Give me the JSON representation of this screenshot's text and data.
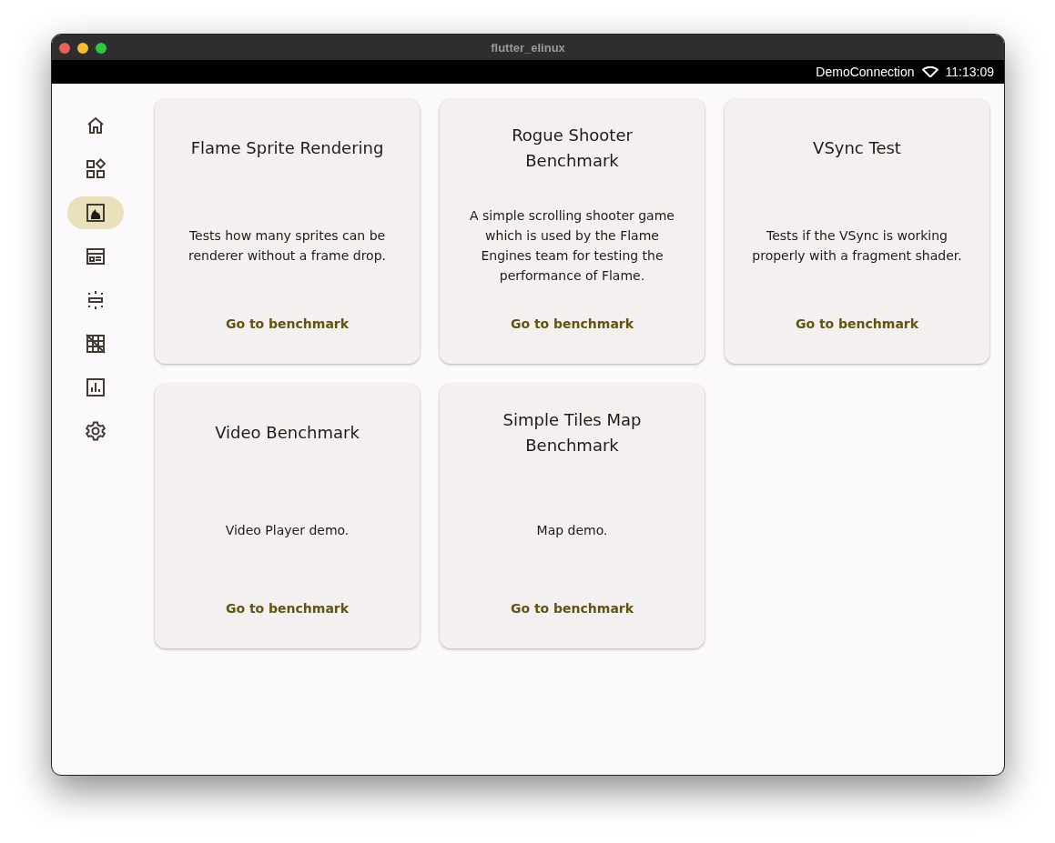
{
  "window": {
    "title": "flutter_elinux"
  },
  "status_bar": {
    "network": "DemoConnection",
    "time": "11:13:09"
  },
  "nav": [
    {
      "kind": "home",
      "selected": false
    },
    {
      "kind": "widgets",
      "selected": false
    },
    {
      "kind": "fireplace",
      "selected": true
    },
    {
      "kind": "newspaper",
      "selected": false
    },
    {
      "kind": "spacing",
      "selected": false
    },
    {
      "kind": "grid-off",
      "selected": false
    },
    {
      "kind": "chart",
      "selected": false
    },
    {
      "kind": "settings",
      "selected": false
    }
  ],
  "cards": [
    {
      "title": "Flame Sprite Rendering",
      "description": "Tests how many sprites can be renderer without a frame drop.",
      "link": "Go to benchmark"
    },
    {
      "title": "Rogue Shooter Benchmark",
      "description": "A simple scrolling shooter game which is used by the Flame Engines team for testing the performance of Flame.",
      "link": "Go to benchmark"
    },
    {
      "title": "VSync Test",
      "description": "Tests if the VSync is working properly with a fragment shader.",
      "link": "Go to benchmark"
    },
    {
      "title": "Video Benchmark",
      "description": "Video Player demo.",
      "link": "Go to benchmark"
    },
    {
      "title": "Simple Tiles Map Benchmark",
      "description": "Map demo.",
      "link": "Go to benchmark"
    }
  ]
}
